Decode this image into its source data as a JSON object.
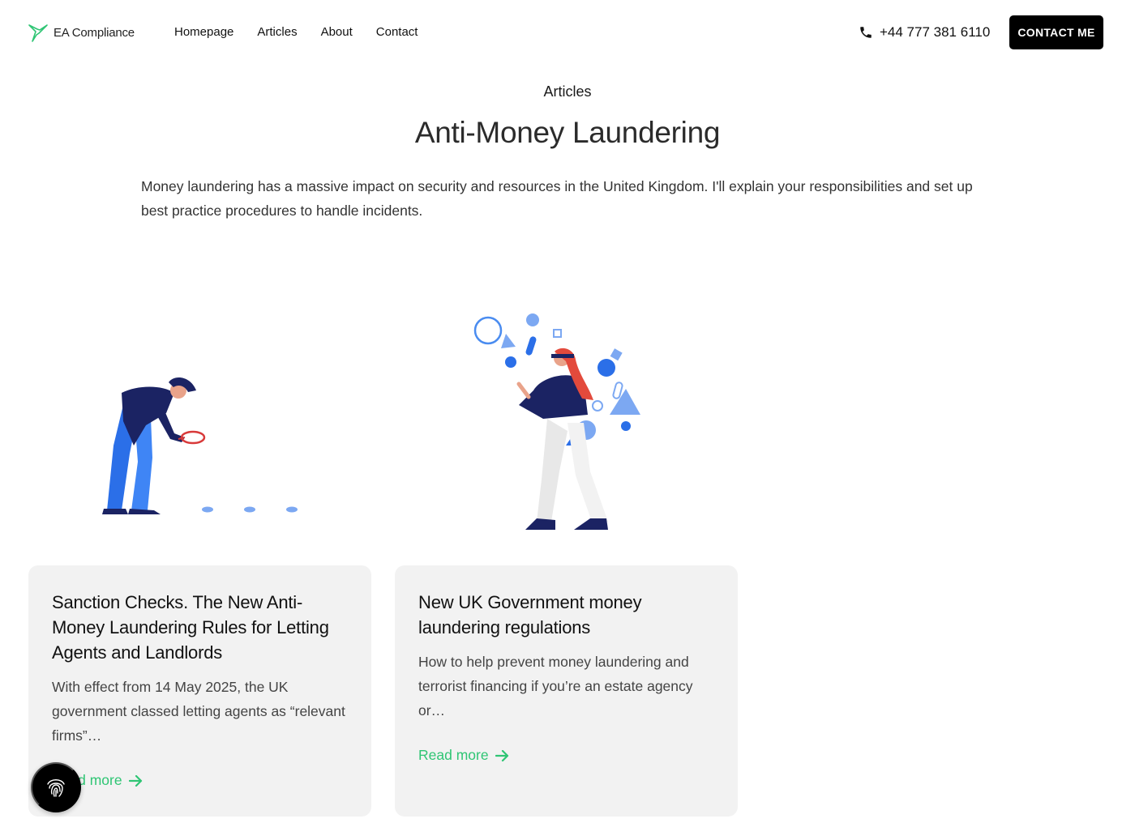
{
  "header": {
    "logo_text": "EA Compliance",
    "nav": [
      "Homepage",
      "Articles",
      "About",
      "Contact"
    ],
    "phone": "+44 777 381 6110",
    "cta_label": "CONTACT ME"
  },
  "hero": {
    "eyebrow": "Articles",
    "title": "Anti-Money Laundering",
    "intro": "Money laundering has a massive impact on security and resources in the United Kingdom. I'll explain your responsibilities and set up best practice procedures to handle incidents."
  },
  "cards": [
    {
      "title": "Sanction Checks. The New Anti-Money Laundering Rules for Letting Agents and Landlords",
      "excerpt": "With effect from 14 May 2025, the UK government classed letting agents as “relevant firms”…",
      "read_more": "Read more"
    },
    {
      "title": "New UK Government money laundering regulations",
      "excerpt": "How to help prevent money laundering and terrorist financing if you’re an estate agency or…",
      "read_more": "Read more"
    }
  ],
  "colors": {
    "accent": "#2fc574",
    "card_bg": "#f2f2f2",
    "cta_bg": "#000000"
  },
  "icons": {
    "logo": "hummingbird-icon",
    "phone": "phone-icon",
    "arrow": "arrow-right-icon",
    "floating": "fingerprint-icon"
  }
}
